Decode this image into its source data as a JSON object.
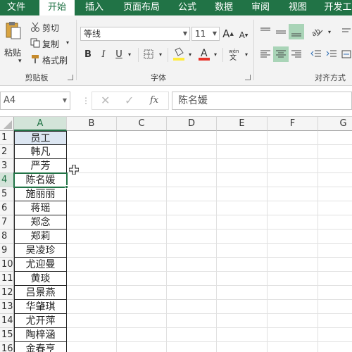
{
  "tabs": [
    "文件",
    "开始",
    "插入",
    "页面布局",
    "公式",
    "数据",
    "审阅",
    "视图",
    "开发工"
  ],
  "ribbon": {
    "clipboard": {
      "paste": "粘贴",
      "cut": "剪切",
      "copy": "复制",
      "format_painter": "格式刷",
      "group": "剪贴板"
    },
    "font": {
      "name": "等线",
      "size": "11",
      "bold": "B",
      "italic": "I",
      "underline": "U",
      "group": "字体"
    },
    "align": {
      "group": "对齐方式"
    }
  },
  "formula_bar": {
    "name_box": "A4",
    "value": "陈名媛"
  },
  "columns": [
    "A",
    "B",
    "C",
    "D",
    "E",
    "F",
    "G"
  ],
  "rows": [
    "1",
    "2",
    "3",
    "4",
    "5",
    "6",
    "7",
    "8",
    "9",
    "10",
    "11",
    "12",
    "13",
    "14",
    "15",
    "16"
  ],
  "cells_a": [
    "员工",
    "韩凡",
    "严芳",
    "陈名媛",
    "施丽丽",
    "蒋瑶",
    "郑念",
    "郑莉",
    "吴凌珍",
    "尤迎曼",
    "黄琰",
    "吕景燕",
    "华肇琪",
    "尤开萍",
    "陶梓涵",
    "金春亨"
  ],
  "colors": {
    "accent": "#217346",
    "selected_fill": "#a9d4b7",
    "header_fill": "#dce6f2",
    "font_color_bar": "#e6332a",
    "fill_color_bar": "#ffeb3b"
  }
}
